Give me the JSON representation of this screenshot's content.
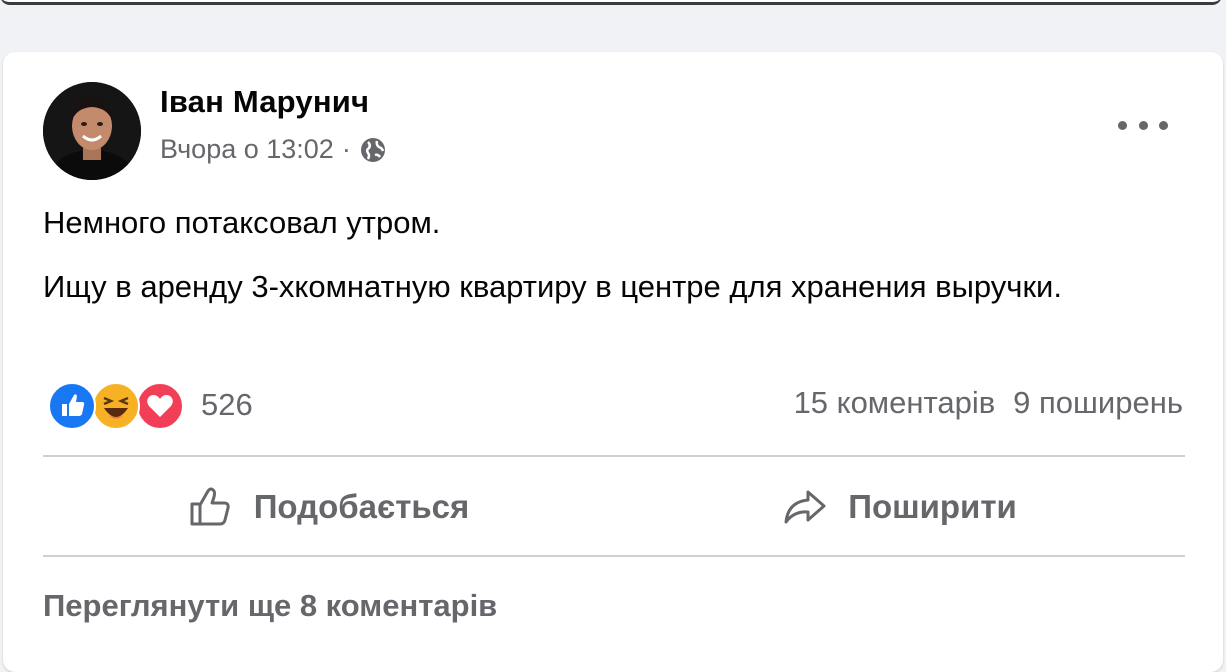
{
  "post": {
    "author": "Іван Марунич",
    "timestamp": "Вчора о 13:02",
    "separator": "·",
    "privacy_icon": "globe-icon",
    "more_icon": "more-dots-icon",
    "text_lines": [
      "Немного потаксовал утром.",
      "Ищу в аренду 3-хкомнатную квартиру в центре для хранения выручки."
    ]
  },
  "reactions": {
    "types": [
      "like-icon",
      "haha-icon",
      "love-icon"
    ],
    "count": "526"
  },
  "stats": {
    "comments": "15 коментарів",
    "shares": "9 поширень"
  },
  "actions": {
    "like_label": "Подобається",
    "share_label": "Поширити"
  },
  "comments": {
    "view_more": "Переглянути ще 8 коментарів"
  },
  "colors": {
    "like": "#1877f2",
    "haha": "#f7b125",
    "love": "#f33e58",
    "secondary_text": "#65676b"
  }
}
